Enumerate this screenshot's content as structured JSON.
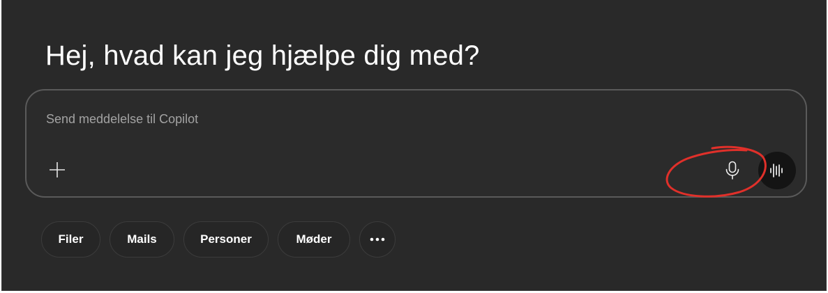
{
  "greeting": "Hej, hvad kan jeg hjælpe dig med?",
  "composer": {
    "placeholder": "Send meddelelse til Copilot",
    "value": "",
    "add_icon": "plus-icon",
    "mic_icon": "microphone-icon",
    "voice_icon": "voice-waveform-icon"
  },
  "chips": [
    {
      "label": "Filer"
    },
    {
      "label": "Mails"
    },
    {
      "label": "Personer"
    },
    {
      "label": "Møder"
    },
    {
      "icon": "more-horizontal-icon"
    }
  ],
  "colors": {
    "background": "#292929",
    "composer_border": "#5a5a5a",
    "placeholder": "#a3a3a3",
    "annotation": "#e0302a"
  }
}
